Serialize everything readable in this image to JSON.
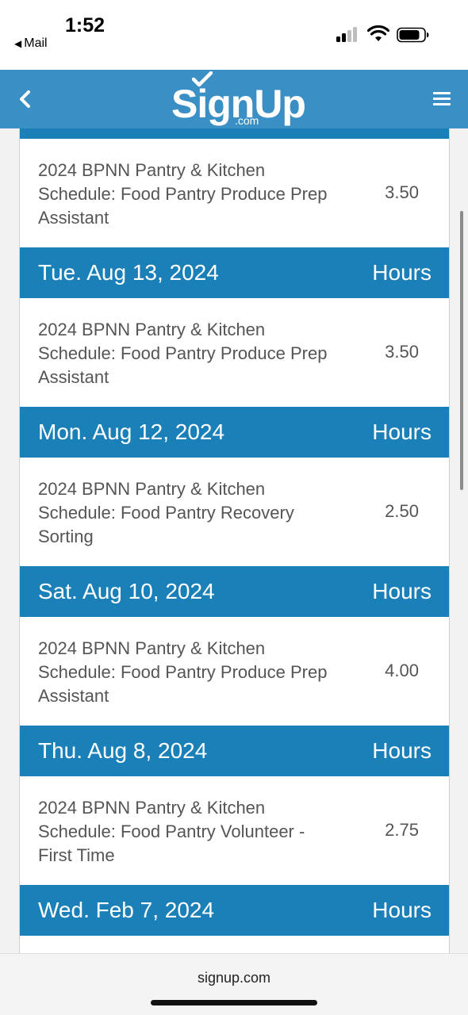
{
  "status_bar": {
    "time": "1:52",
    "back_app": "Mail",
    "back_arrow": "◀"
  },
  "header": {
    "logo_main": "SignUp",
    "logo_sub": ".com",
    "back_icon": "chevron-left-icon",
    "menu_icon": "hamburger-menu-icon",
    "background_color": "#3a8fc4"
  },
  "schedule": {
    "first_task": {
      "name": "2024 BPNN Pantry & Kitchen Schedule: Food Pantry Produce Prep Assistant",
      "hours": "3.50"
    },
    "groups": [
      {
        "date": "Tue. Aug 13, 2024",
        "hours_header": "Hours",
        "task": {
          "name": "2024 BPNN Pantry & Kitchen Schedule: Food Pantry Produce Prep Assistant",
          "hours": "3.50"
        }
      },
      {
        "date": "Mon. Aug 12, 2024",
        "hours_header": "Hours",
        "task": {
          "name": "2024 BPNN Pantry & Kitchen Schedule: Food Pantry Recovery Sorting",
          "hours": "2.50"
        }
      },
      {
        "date": "Sat. Aug 10, 2024",
        "hours_header": "Hours",
        "task": {
          "name": "2024 BPNN Pantry & Kitchen Schedule: Food Pantry Produce Prep Assistant",
          "hours": "4.00"
        }
      },
      {
        "date": "Thu. Aug 8, 2024",
        "hours_header": "Hours",
        "task": {
          "name": "2024 BPNN Pantry & Kitchen Schedule: Food Pantry Volunteer - First Time",
          "hours": "2.75"
        }
      },
      {
        "date": "Wed. Feb 7, 2024",
        "hours_header": "Hours"
      }
    ],
    "header_color": "#1b80b8"
  },
  "browser": {
    "url": "signup.com"
  }
}
